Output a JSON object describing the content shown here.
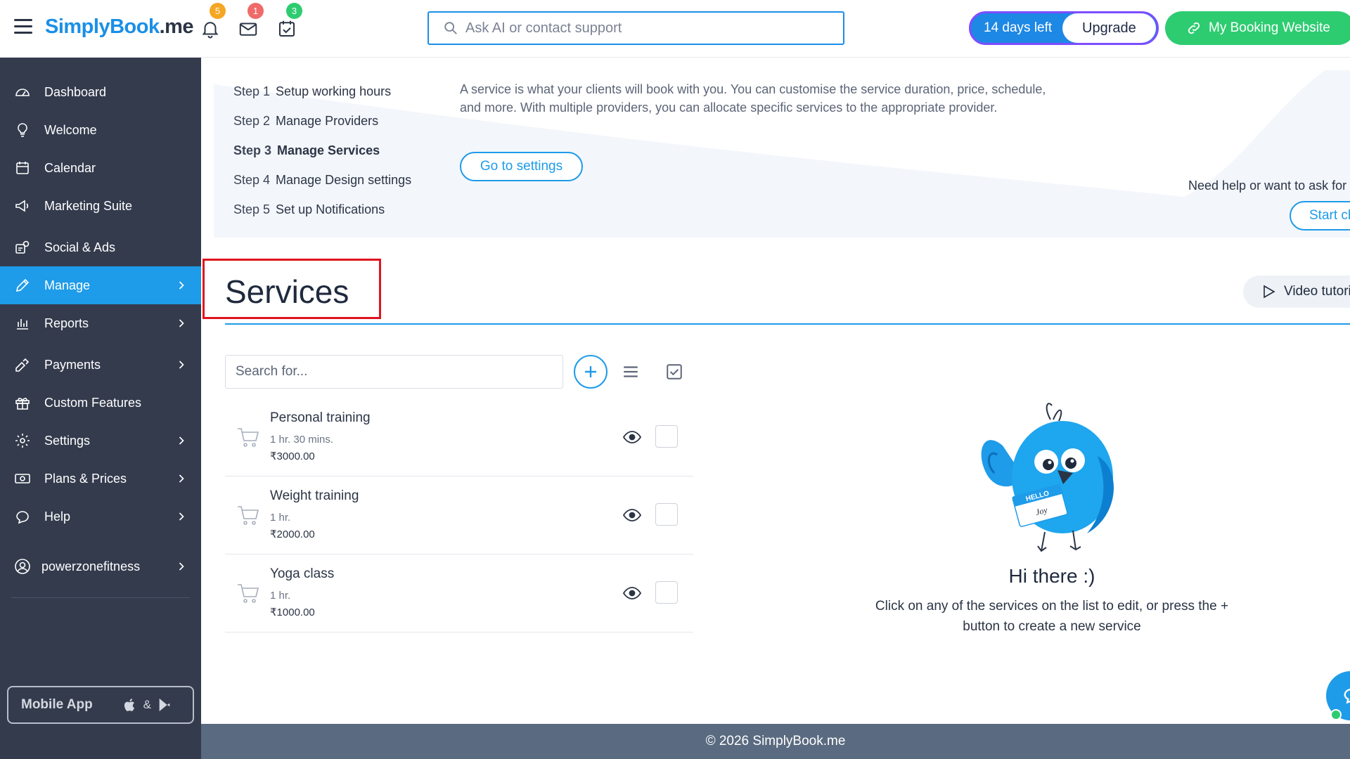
{
  "header": {
    "logo_main": "SimplyBook",
    "logo_suffix": ".me",
    "notifications_count": "5",
    "messages_count": "1",
    "tasks_count": "3",
    "search_placeholder": "Ask AI or contact support",
    "trial_text": "14 days left",
    "upgrade_label": "Upgrade",
    "booking_label": "My Booking Website"
  },
  "sidebar": {
    "items": [
      {
        "label": "Dashboard"
      },
      {
        "label": "Welcome"
      },
      {
        "label": "Calendar"
      },
      {
        "label": "Marketing Suite"
      },
      {
        "label": "Social & Ads"
      },
      {
        "label": "Manage"
      },
      {
        "label": "Reports"
      },
      {
        "label": "Payments"
      },
      {
        "label": "Custom Features"
      },
      {
        "label": "Settings"
      },
      {
        "label": "Plans & Prices"
      },
      {
        "label": "Help"
      }
    ],
    "account": "powerzonefitness",
    "mobile_app": "Mobile App",
    "mobile_amp": "&"
  },
  "steps": {
    "items": [
      {
        "num": "Step 1",
        "label": "Setup working hours"
      },
      {
        "num": "Step 2",
        "label": "Manage Providers"
      },
      {
        "num": "Step 3",
        "label": "Manage Services"
      },
      {
        "num": "Step 4",
        "label": "Manage Design settings"
      },
      {
        "num": "Step 5",
        "label": "Set up Notifications"
      }
    ],
    "description": "A service is what your clients will book with you. You can customise the service duration, price, schedule, and more. With multiple providers, you can allocate specific services to the appropriate provider.",
    "goto_label": "Go to settings",
    "help_text": "Need help or want to ask for set",
    "chat_label": "Start cha"
  },
  "page": {
    "title": "Services",
    "video_label": "Video tutori",
    "search_placeholder": "Search for..."
  },
  "services": [
    {
      "name": "Personal training",
      "duration": "1 hr. 30 mins.",
      "price": "₹3000.00"
    },
    {
      "name": "Weight training",
      "duration": "1 hr.",
      "price": "₹2000.00"
    },
    {
      "name": "Yoga class",
      "duration": "1 hr.",
      "price": "₹1000.00"
    }
  ],
  "empty_state": {
    "badge_hello": "HELLO",
    "badge_name": "Joy",
    "title": "Hi there :)",
    "text": "Click on any of the services on the list to edit, or press the + button to create a new service"
  },
  "footer": {
    "copyright": "© 2026 SimplyBook.me"
  },
  "colors": {
    "accent": "#1e9be9",
    "sidebar_bg": "#343b4d",
    "green": "#2ecc71",
    "highlight_red": "#e0141e"
  }
}
